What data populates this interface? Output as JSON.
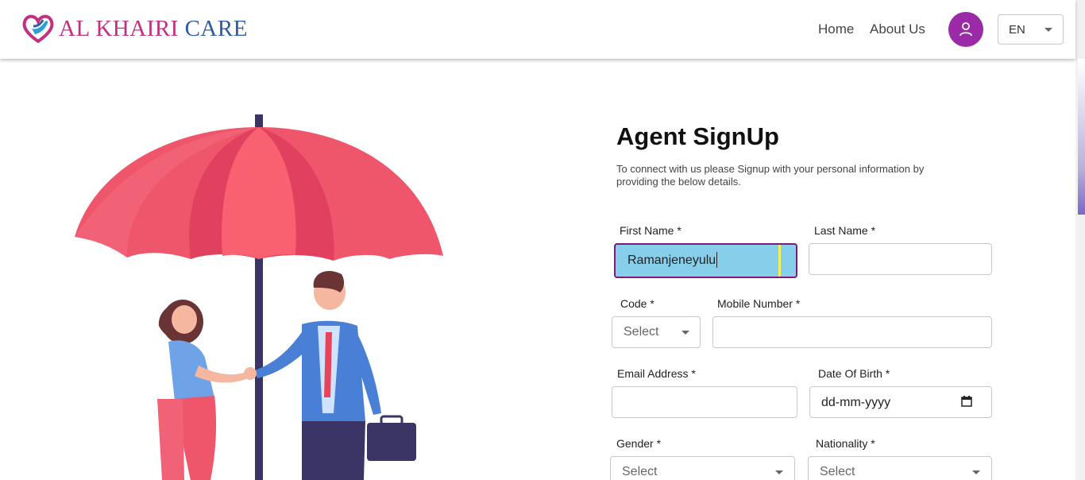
{
  "header": {
    "brand_part1": "AL KHAIRI",
    "brand_part2": "CARE",
    "nav": [
      "Home",
      "About Us"
    ],
    "language": "EN"
  },
  "form": {
    "title": "Agent SignUp",
    "subtitle": "To connect with us please Signup with your personal information by providing the below details.",
    "fields": {
      "first_name": {
        "label": "First Name *",
        "value": "Ramanjeneyulu"
      },
      "last_name": {
        "label": "Last Name *",
        "value": ""
      },
      "code": {
        "label": "Code *",
        "selected": "Select"
      },
      "mobile": {
        "label": "Mobile Number *",
        "value": ""
      },
      "email": {
        "label": "Email Address *",
        "value": ""
      },
      "dob": {
        "label": "Date Of Birth *",
        "placeholder": "dd-mm-yyyy"
      },
      "gender": {
        "label": "Gender *",
        "selected": "Select"
      },
      "nationality": {
        "label": "Nationality *",
        "selected": "Select"
      }
    }
  },
  "colors": {
    "brand_pink": "#c2307f",
    "brand_blue": "#2e5aa6",
    "avatar_purple": "#9b2aa9",
    "active_field_bg": "#87ceeb",
    "umbrella_red": "#f0566b"
  },
  "icons": [
    "heart-hand-logo-icon",
    "user-icon",
    "chevron-down-icon",
    "calendar-icon"
  ]
}
